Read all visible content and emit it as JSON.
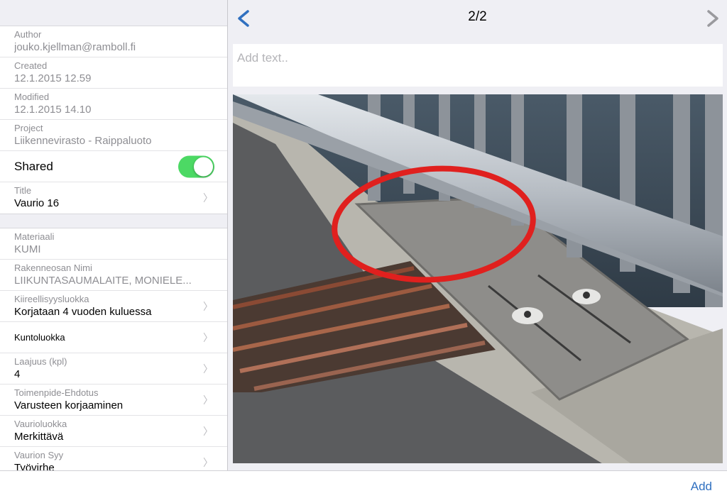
{
  "sidebar": {
    "author": {
      "label": "Author",
      "value": "jouko.kjellman@ramboll.fi"
    },
    "created": {
      "label": "Created",
      "value": "12.1.2015 12.59"
    },
    "modified": {
      "label": "Modified",
      "value": "12.1.2015 14.10"
    },
    "project": {
      "label": "Project",
      "value": "Liikennevirasto - Raippaluoto"
    },
    "shared": {
      "label": "Shared",
      "enabled": true
    },
    "title": {
      "label": "Title",
      "value": "Vaurio 16"
    },
    "fields": [
      {
        "label": "Materiaali",
        "value": "KUMI"
      },
      {
        "label": "Rakenneosan Nimi",
        "value": "LIIKUNTASAUMALAITE, MONIELE..."
      },
      {
        "label": "Kiireellisyysluokka",
        "value": "Korjataan 4 vuoden kuluessa"
      },
      {
        "label": "Kuntoluokka"
      },
      {
        "label": "Laajuus (kpl)",
        "value": "4"
      },
      {
        "label": "Toimenpide-Ehdotus",
        "value": "Varusteen korjaaminen"
      },
      {
        "label": "Vaurioluokka",
        "value": "Merkittävä"
      },
      {
        "label": "Vaurion Syy",
        "value": "Työvirhe"
      }
    ]
  },
  "main": {
    "counter": "2/2",
    "text_placeholder": "Add text..",
    "back_icon": "chevron-left-icon",
    "forward_icon": "chevron-right-icon"
  },
  "bottom": {
    "add_label": "Add"
  },
  "colors": {
    "accent": "#3070c0",
    "toggle_on": "#4cd964",
    "annotation": "#e0201e"
  }
}
